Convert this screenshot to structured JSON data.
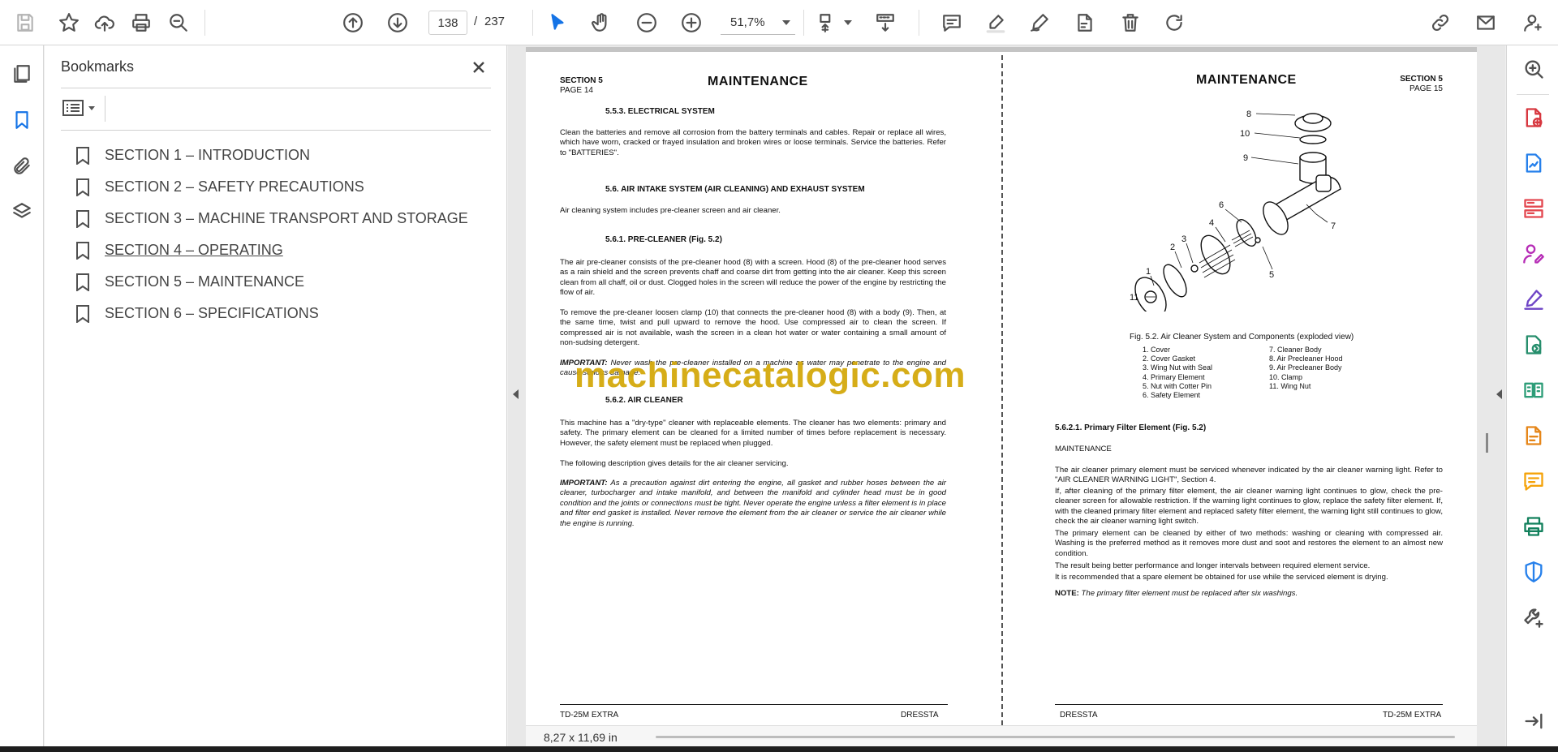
{
  "toolbar": {
    "current_page": "138",
    "page_separator": "/",
    "total_pages": "237",
    "zoom": "51,7%"
  },
  "colors": {
    "accent_blue": "#1473e6",
    "watermark": "#d4a90c",
    "right_rail_icons": [
      "#d7373f",
      "#2680eb",
      "#e34850",
      "#b62cb6",
      "#6e44c6",
      "#268e6c",
      "#2d9d78",
      "#e68619",
      "#f5a30a",
      "#12805c",
      "#2680eb",
      "#505050"
    ]
  },
  "bookmarks": {
    "title": "Bookmarks",
    "items": [
      {
        "label": "SECTION 1 – INTRODUCTION"
      },
      {
        "label": "SECTION 2 – SAFETY PRECAUTIONS"
      },
      {
        "label": "SECTION 3 – MACHINE TRANSPORT AND STORAGE"
      },
      {
        "label": "SECTION 4 – OPERATING"
      },
      {
        "label": "SECTION 5 – MAINTENANCE"
      },
      {
        "label": "SECTION 6 – SPECIFICATIONS"
      }
    ]
  },
  "left_page": {
    "section": "SECTION 5",
    "page": "PAGE 14",
    "title": "MAINTENANCE",
    "h_553": "5.5.3. ELECTRICAL SYSTEM",
    "p_553": "Clean the batteries and remove all corrosion from the battery terminals and cables. Repair or replace all wires, which have worn, cracked or frayed insulation and broken wires or loose terminals. Service the batteries. Refer to \"BATTERIES\".",
    "h_56": "5.6. AIR INTAKE SYSTEM (AIR CLEANING) AND EXHAUST SYSTEM",
    "p_56": "Air cleaning system includes pre-cleaner screen and air cleaner.",
    "h_561": "5.6.1. PRE-CLEANER (Fig. 5.2)",
    "p_561a": "The air pre-cleaner consists of the pre-cleaner hood (8) with a screen. Hood (8) of the pre-cleaner hood serves as a rain shield and the screen prevents chaff and coarse dirt from getting into the air cleaner. Keep this screen clean from all chaff, oil or dust. Clogged holes in the screen will reduce the power of the engine by restricting the flow of air.",
    "p_561b": "To remove the pre-cleaner loosen clamp (10) that connects the pre-cleaner hood (8) with a body (9). Then, at the same time, twist and pull upward to remove the hood. Use compressed air to clean the screen. If compressed air is not available, wash the screen in a clean hot water or water containing a small amount of non-sudsing detergent.",
    "imp1_label": "IMPORTANT:",
    "imp1_text": " Never wash the pre-cleaner installed on a machine as water may penetrate to the engine and cause serious damage.",
    "h_562": "5.6.2. AIR CLEANER",
    "p_562a": "This machine has a \"dry-type\" cleaner with replaceable elements. The cleaner has two elements: primary and safety. The primary element can be cleaned for a limited number of times before replacement is necessary. However, the safety element must be replaced when plugged.",
    "p_562b": "The following description gives details for the air cleaner servicing.",
    "imp2_label": "IMPORTANT:",
    "imp2_text": " As a precaution against dirt entering the engine, all gasket and rubber hoses between the air cleaner, turbocharger and intake manifold, and between the manifold and cylinder head must be in good condition and the joints or connections must be tight. Never operate the engine unless a filter element is in place and filter end gasket is installed. Never remove the element from the air cleaner or service the air cleaner while the engine is running.",
    "footer_left": "TD-25M EXTRA",
    "footer_right": "DRESSTA"
  },
  "right_page": {
    "title": "MAINTENANCE",
    "section": "SECTION 5",
    "page": "PAGE 15",
    "fig_caption": "Fig. 5.2. Air Cleaner System and Components (exploded view)",
    "legend_left": [
      "1. Cover",
      "2. Cover Gasket",
      "3. Wing Nut with Seal",
      "4. Primary Element",
      "5. Nut with Cotter Pin",
      "6. Safety Element"
    ],
    "legend_right": [
      "7. Cleaner Body",
      "8. Air Precleaner Hood",
      "9. Air Precleaner Body",
      "10. Clamp",
      "11. Wing Nut"
    ],
    "callouts": [
      "8",
      "10",
      "9",
      "6",
      "4",
      "3",
      "2",
      "1",
      "11",
      "5",
      "7"
    ],
    "h_5621": "5.6.2.1. Primary Filter Element (Fig. 5.2)",
    "sub": "MAINTENANCE",
    "p1": "The air cleaner primary element must be serviced whenever indicated by the air cleaner warning light. Refer to \"AIR CLEANER WARNING LIGHT\", Section 4.",
    "p2": "If, after cleaning of the primary filter element, the air cleaner warning light continues to glow, check the pre-cleaner screen for allowable restriction. If the warning light continues to glow, replace the safety filter element. If, with the cleaned primary filter element and replaced safety filter element, the warning light still continues to glow, check the air cleaner warning light switch.",
    "p3": "The primary element can be cleaned by either of two methods: washing or cleaning with compressed air. Washing is the preferred method as it removes more dust and soot and restores the element to an almost new condition.",
    "p4": "The result being better performance and longer intervals between required element service.",
    "p5": "It is recommended that a spare element be obtained for use while the serviced element is drying.",
    "note_label": "NOTE:",
    "note_text": " The primary filter element must be replaced after six washings.",
    "footer_left": "DRESSTA",
    "footer_right": "TD-25M EXTRA"
  },
  "watermark": "machinecatalogic.com",
  "status": {
    "page_size": "8,27 x 11,69 in"
  }
}
